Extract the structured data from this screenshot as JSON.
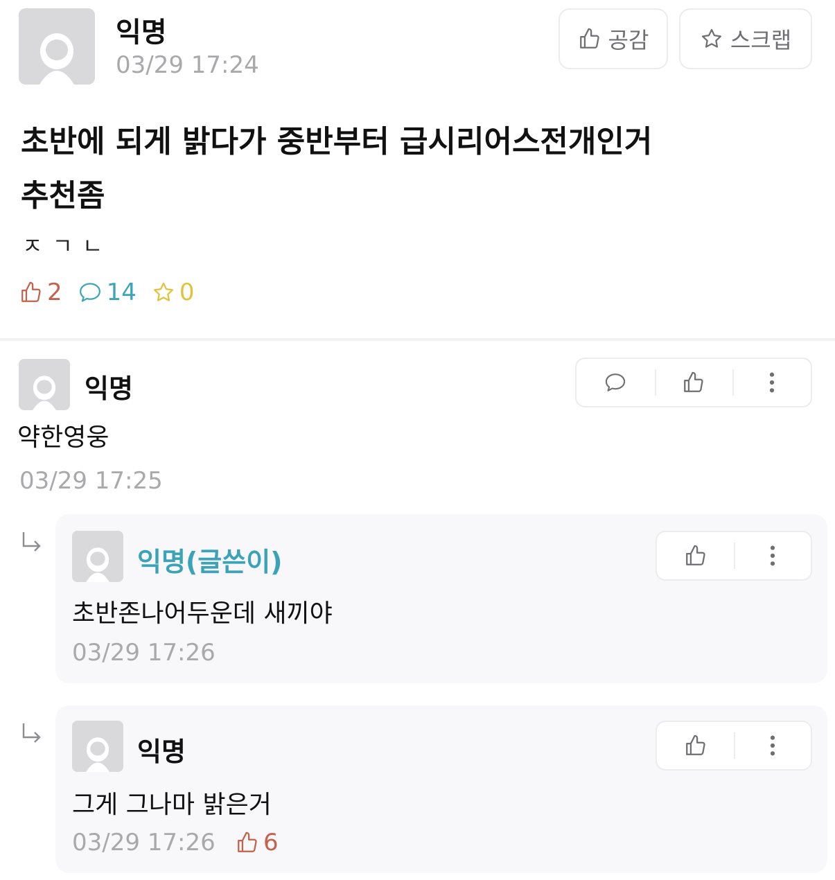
{
  "post": {
    "author": "익명",
    "timestamp": "03/29 17:24",
    "like_button_label": "공감",
    "scrap_button_label": "스크랩",
    "title_line1": "초반에 되게 밝다가 중반부터 급시리어스전개인거",
    "title_line2": "추천좀",
    "body": "ㅈㄱㄴ",
    "stats": {
      "likes": "2",
      "comments": "14",
      "scraps": "0"
    }
  },
  "comments": [
    {
      "author": "익명",
      "text": "약한영웅",
      "timestamp": "03/29 17:25"
    }
  ],
  "replies": [
    {
      "author": "익명(글쓴이)",
      "text": "초반존나어두운데 새끼야",
      "timestamp": "03/29 17:26"
    },
    {
      "author": "익명",
      "text": "그게 그나마 밝은거",
      "timestamp": "03/29 17:26",
      "likes": "6"
    }
  ],
  "colors": {
    "writer_accent": "#3ba3b7",
    "like": "#c4614a",
    "comment": "#3aa5b9",
    "scrap": "#e3c23a",
    "muted": "#a9a9ac"
  }
}
